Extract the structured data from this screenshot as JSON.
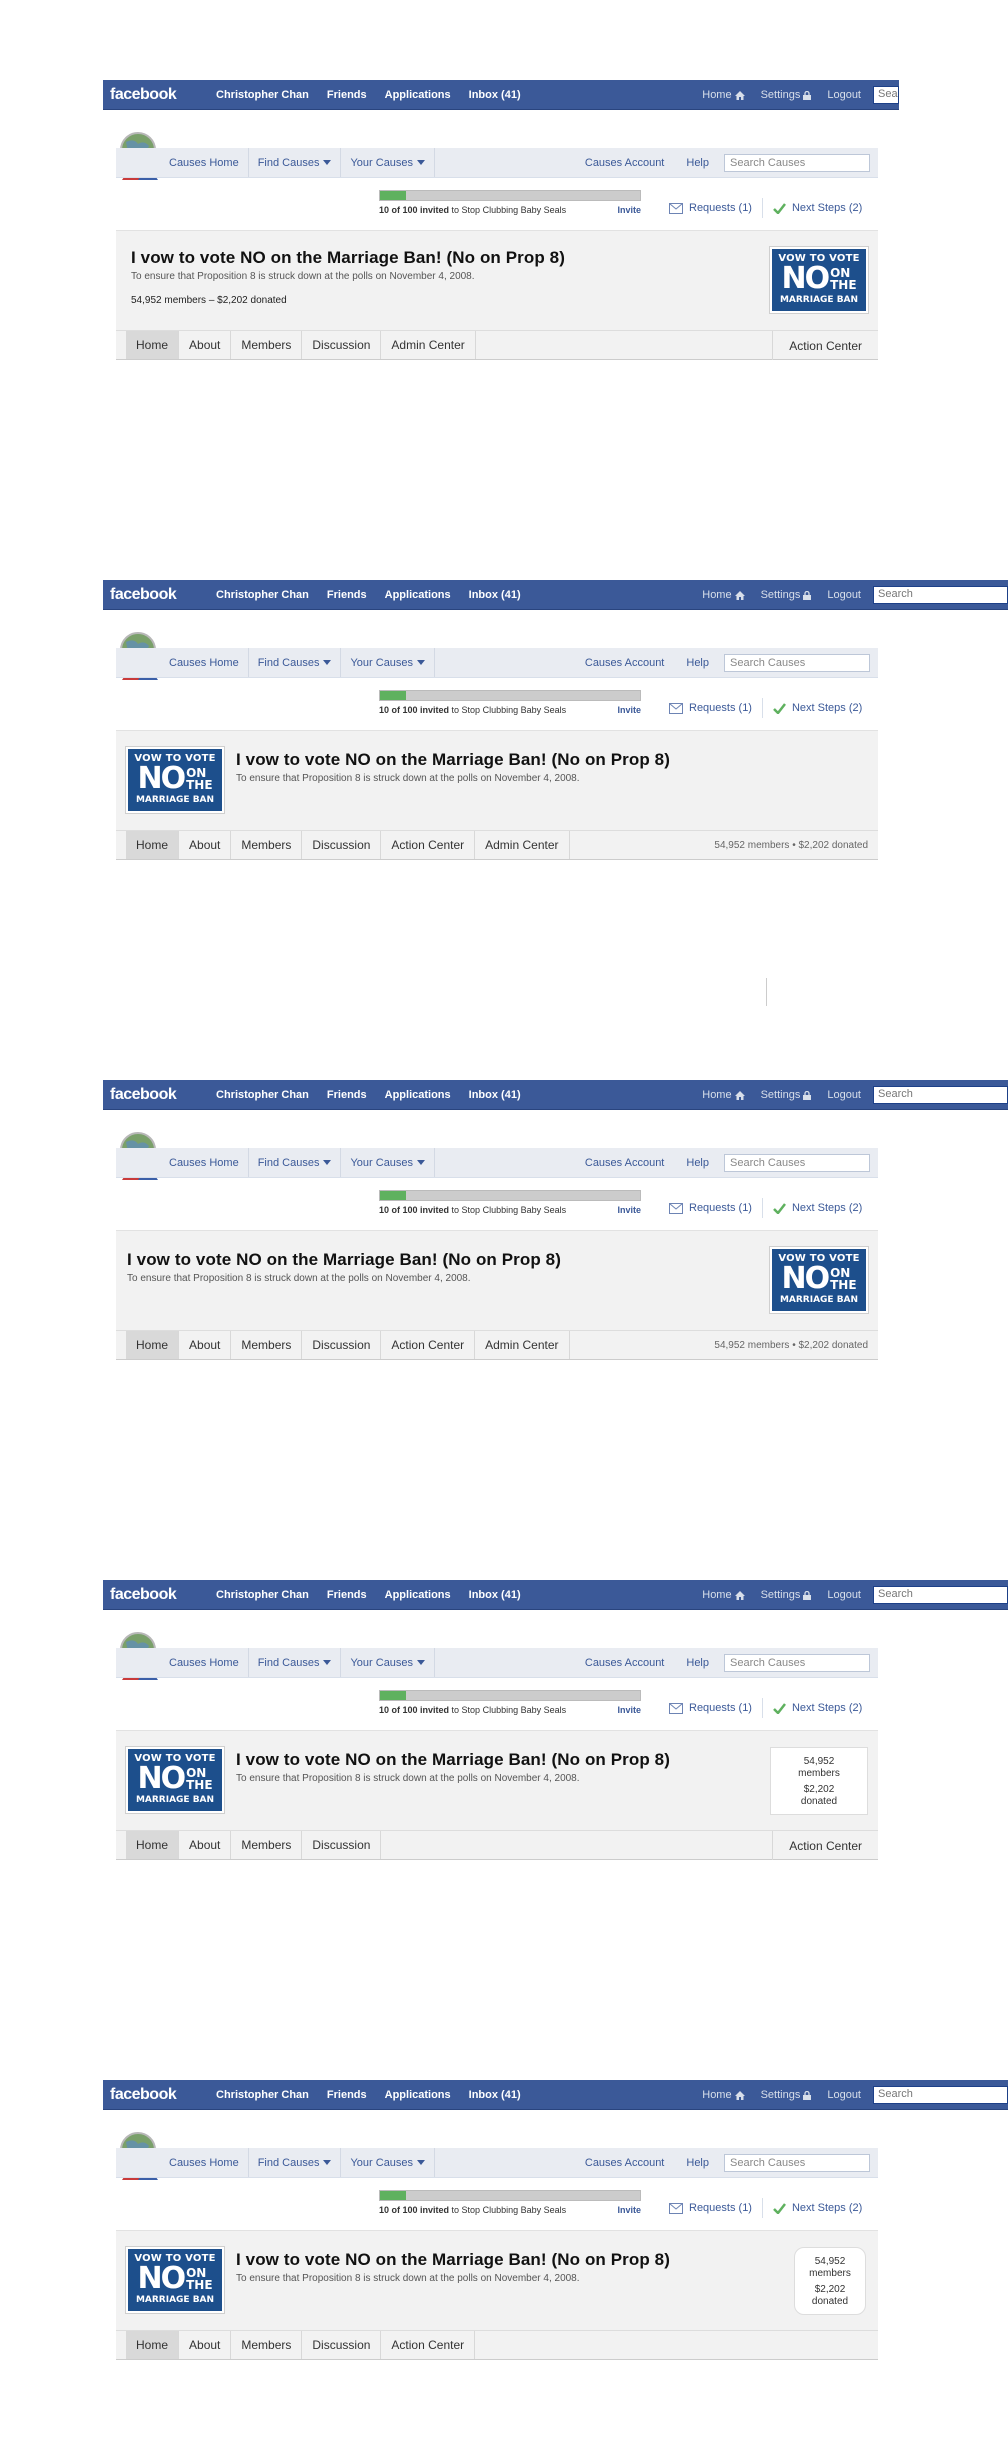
{
  "fb": {
    "logo": "facebook",
    "user": "Christopher Chan",
    "friends": "Friends",
    "applications": "Applications",
    "inbox": "Inbox (41)",
    "home": "Home",
    "settings": "Settings",
    "logout": "Logout",
    "search_short": "Searc",
    "search": "Search",
    "brand_color": "#3b5998"
  },
  "causes": {
    "home": "Causes Home",
    "find": "Find Causes",
    "yours": "Your Causes",
    "account": "Causes Account",
    "help": "Help",
    "search_placeholder": "Search Causes"
  },
  "invite": {
    "progress_fraction": 0.1,
    "count": "10 of 100 invited",
    "target": "to Stop Clubbing Baby Seals",
    "link": "Invite",
    "requests": "Requests (1)",
    "next_steps": "Next Steps (2)"
  },
  "cause": {
    "title": "I vow to vote NO on the Marriage Ban! (No on Prop 8)",
    "subtitle": "To ensure that Proposition 8 is struck down at the polls on November 4, 2008.",
    "stats": "54,952 members – $2,202 donated",
    "stats_dot": "54,952 members • $2,202 donated",
    "members_num": "54,952",
    "members_label": "members",
    "donated_num": "$2,202",
    "donated_label": "donated",
    "badge_line1": "VOW TO VOTE",
    "badge_no": "NO",
    "badge_on": "ON",
    "badge_the": "THE",
    "badge_line3": "MARRIAGE BAN"
  },
  "tabs": {
    "home": "Home",
    "about": "About",
    "members": "Members",
    "discussion": "Discussion",
    "admin": "Admin Center",
    "action": "Action Center"
  }
}
